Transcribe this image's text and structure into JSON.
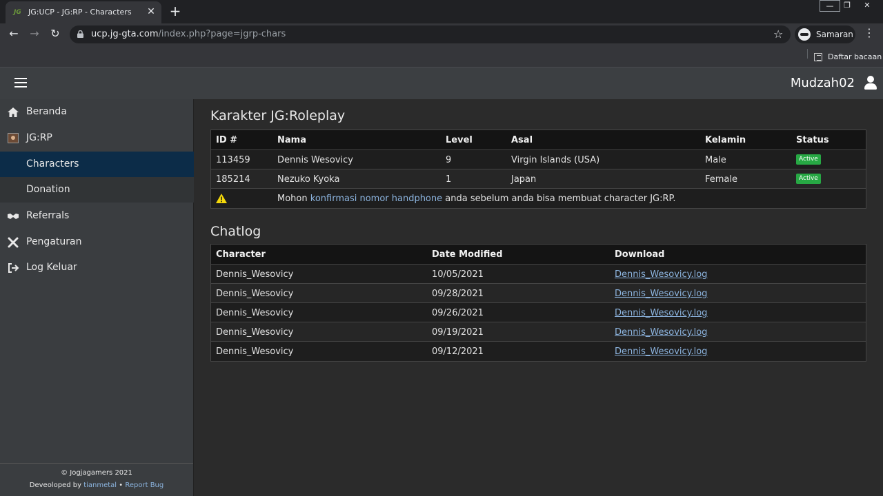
{
  "browser": {
    "tab_title": "JG:UCP - JG:RP - Characters",
    "tab_favicon": "JG",
    "url_host": "ucp.jg-gta.com",
    "url_path": "/index.php?page=jgrp-chars",
    "profile_label": "Samaran",
    "reading_list_label": "Daftar bacaan"
  },
  "header": {
    "username": "Mudzah02"
  },
  "sidebar": {
    "items": [
      {
        "label": "Beranda",
        "icon": "home-icon"
      },
      {
        "label": "JG:RP",
        "icon": "jgrp-icon"
      },
      {
        "label": "Characters",
        "icon": ""
      },
      {
        "label": "Donation",
        "icon": ""
      },
      {
        "label": "Referrals",
        "icon": "handshake-icon"
      },
      {
        "label": "Pengaturan",
        "icon": "tools-icon"
      },
      {
        "label": "Log Keluar",
        "icon": "sign-out-icon"
      }
    ],
    "footer": {
      "copyright": "© Jogjagamers 2021",
      "developed_prefix": "Deveoloped by",
      "developer": "tianmetal",
      "separator": "•",
      "report_bug": "Report Bug"
    }
  },
  "characters": {
    "title": "Karakter JG:Roleplay",
    "columns": [
      "ID #",
      "Nama",
      "Level",
      "Asal",
      "Kelamin",
      "Status"
    ],
    "rows": [
      {
        "id": "113459",
        "name": "Dennis Wesovicy",
        "level": "9",
        "origin": "Virgin Islands (USA)",
        "gender": "Male",
        "status": "Active"
      },
      {
        "id": "185214",
        "name": "Nezuko Kyoka",
        "level": "1",
        "origin": "Japan",
        "gender": "Female",
        "status": "Active"
      }
    ],
    "warning": {
      "prefix": "Mohon",
      "link": "konfirmasi nomor handphone",
      "suffix": "anda sebelum anda bisa membuat character JG:RP."
    }
  },
  "chatlog": {
    "title": "Chatlog",
    "columns": [
      "Character",
      "Date Modified",
      "Download"
    ],
    "rows": [
      {
        "character": "Dennis_Wesovicy",
        "date": "10/05/2021",
        "file": "Dennis_Wesovicy.log"
      },
      {
        "character": "Dennis_Wesovicy",
        "date": "09/28/2021",
        "file": "Dennis_Wesovicy.log"
      },
      {
        "character": "Dennis_Wesovicy",
        "date": "09/26/2021",
        "file": "Dennis_Wesovicy.log"
      },
      {
        "character": "Dennis_Wesovicy",
        "date": "09/19/2021",
        "file": "Dennis_Wesovicy.log"
      },
      {
        "character": "Dennis_Wesovicy",
        "date": "09/12/2021",
        "file": "Dennis_Wesovicy.log"
      }
    ]
  },
  "colors": {
    "active_badge": "#27a844",
    "active_menu": "#0c2c48",
    "link": "#8cb4df",
    "warning": "#f5d90a"
  }
}
